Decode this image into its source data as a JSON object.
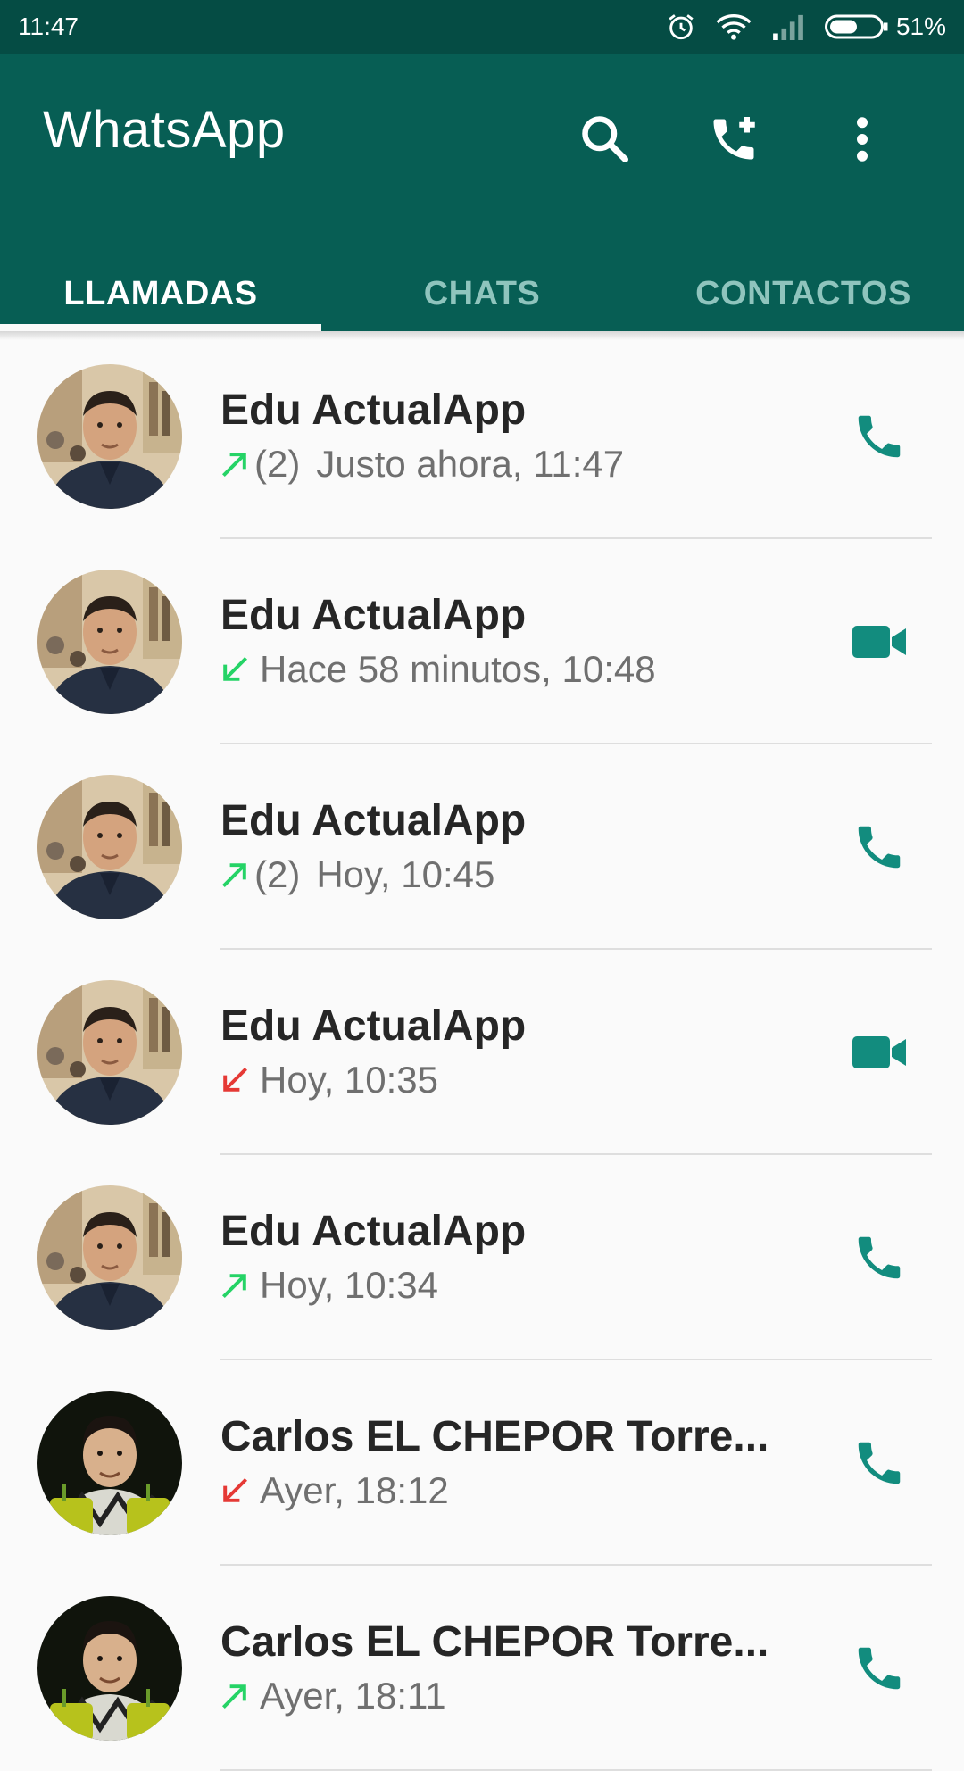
{
  "status_bar": {
    "time": "11:47",
    "battery": "51%",
    "icons": [
      "alarm-icon",
      "wifi-icon",
      "signal-icon",
      "battery-icon"
    ]
  },
  "app_bar": {
    "title": "WhatsApp",
    "actions": [
      "search-icon",
      "new-call-icon",
      "more-options-icon"
    ]
  },
  "tabs": [
    {
      "label": "LLAMADAS",
      "active": true
    },
    {
      "label": "CHATS",
      "active": false
    },
    {
      "label": "CONTACTOS",
      "active": false
    }
  ],
  "colors": {
    "primary": "#075e54",
    "status_bar": "#054c44",
    "accent": "#128c7e",
    "outgoing_arrow": "#25d366",
    "missed_arrow": "#e53935"
  },
  "calls": [
    {
      "name": "Edu ActualApp",
      "direction": "outgoing",
      "count": "(2)",
      "time": "Justo ahora, 11:47",
      "type": "voice",
      "avatar": "edu"
    },
    {
      "name": "Edu ActualApp",
      "direction": "incoming",
      "count": "",
      "time": "Hace 58 minutos, 10:48",
      "type": "video",
      "avatar": "edu"
    },
    {
      "name": "Edu ActualApp",
      "direction": "outgoing",
      "count": "(2)",
      "time": "Hoy, 10:45",
      "type": "voice",
      "avatar": "edu"
    },
    {
      "name": "Edu ActualApp",
      "direction": "missed",
      "count": "",
      "time": "Hoy, 10:35",
      "type": "video",
      "avatar": "edu"
    },
    {
      "name": "Edu ActualApp",
      "direction": "outgoing",
      "count": "",
      "time": "Hoy, 10:34",
      "type": "voice",
      "avatar": "edu"
    },
    {
      "name": "Carlos EL CHEPOR Torre...",
      "direction": "missed",
      "count": "",
      "time": "Ayer, 18:12",
      "type": "voice",
      "avatar": "carlos"
    },
    {
      "name": "Carlos EL CHEPOR Torre...",
      "direction": "outgoing",
      "count": "",
      "time": "Ayer, 18:11",
      "type": "voice",
      "avatar": "carlos"
    }
  ]
}
